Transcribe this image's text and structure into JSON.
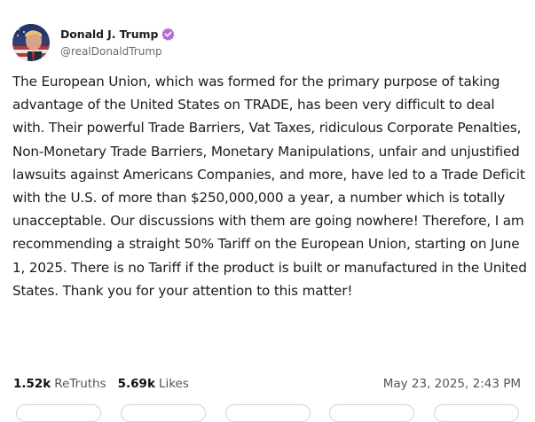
{
  "author": {
    "display_name": "Donald J. Trump",
    "handle": "@realDonaldTrump",
    "verified": true,
    "avatar_icon": "profile-photo-icon",
    "verified_icon": "verified-badge-icon",
    "verified_color": "#b36dd6"
  },
  "post": {
    "text": "The European Union, which was formed for the primary purpose of taking advantage of the United States on TRADE, has been very difficult to deal with. Their powerful Trade Barriers, Vat Taxes, ridiculous Corporate Penalties, Non-Monetary Trade Barriers, Monetary Manipulations, unfair and unjustified lawsuits against Americans Companies, and more, have led to a Trade Deficit with the U.S. of more than $250,000,000 a year, a number which is totally unacceptable. Our discussions with them are going nowhere! Therefore, I am recommending a straight 50% Tariff on the European Union, starting on June 1, 2025. There is no Tariff if the product is built or manufactured in the United States. Thank you for your attention to this matter!"
  },
  "stats": {
    "retruths_count": "1.52k",
    "retruths_label": "ReTruths",
    "likes_count": "5.69k",
    "likes_label": "Likes"
  },
  "timestamp": "May 23, 2025, 2:43 PM"
}
